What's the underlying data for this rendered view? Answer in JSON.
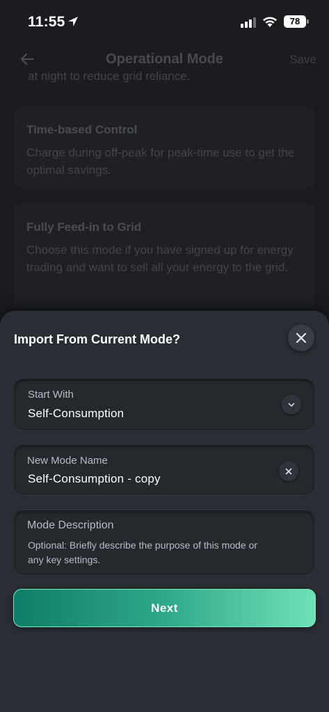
{
  "status_bar": {
    "time": "11:55",
    "battery": "78"
  },
  "background": {
    "title": "Operational Mode",
    "save_label": "Save",
    "partial_text": "at night to reduce grid reliance.",
    "modes": [
      {
        "title": "Time-based Control",
        "description": "Charge during off-peak for peak-time use to get the optimal savings."
      },
      {
        "title": "Fully Feed-in to Grid",
        "description": "Choose this mode if you have signed up for energy trading and want to sell all your energy to the grid."
      }
    ]
  },
  "sheet": {
    "title": "Import From Current Mode?",
    "start_with": {
      "label": "Start With",
      "value": "Self-Consumption"
    },
    "new_mode_name": {
      "label": "New Mode Name",
      "value": "Self-Consumption - copy"
    },
    "mode_description": {
      "label": "Mode Description",
      "placeholder": "Optional: Briefly describe the purpose of this mode or any key settings."
    },
    "next_label": "Next"
  },
  "colors": {
    "sheet_bg": "#2a2d33",
    "button_gradient_start": "#0d7e66",
    "button_gradient_end": "#6ee1b7"
  },
  "icons": [
    "location-arrow-icon",
    "signal-icon",
    "wifi-icon",
    "back-arrow-icon",
    "close-icon",
    "chevron-down-icon",
    "clear-icon"
  ]
}
